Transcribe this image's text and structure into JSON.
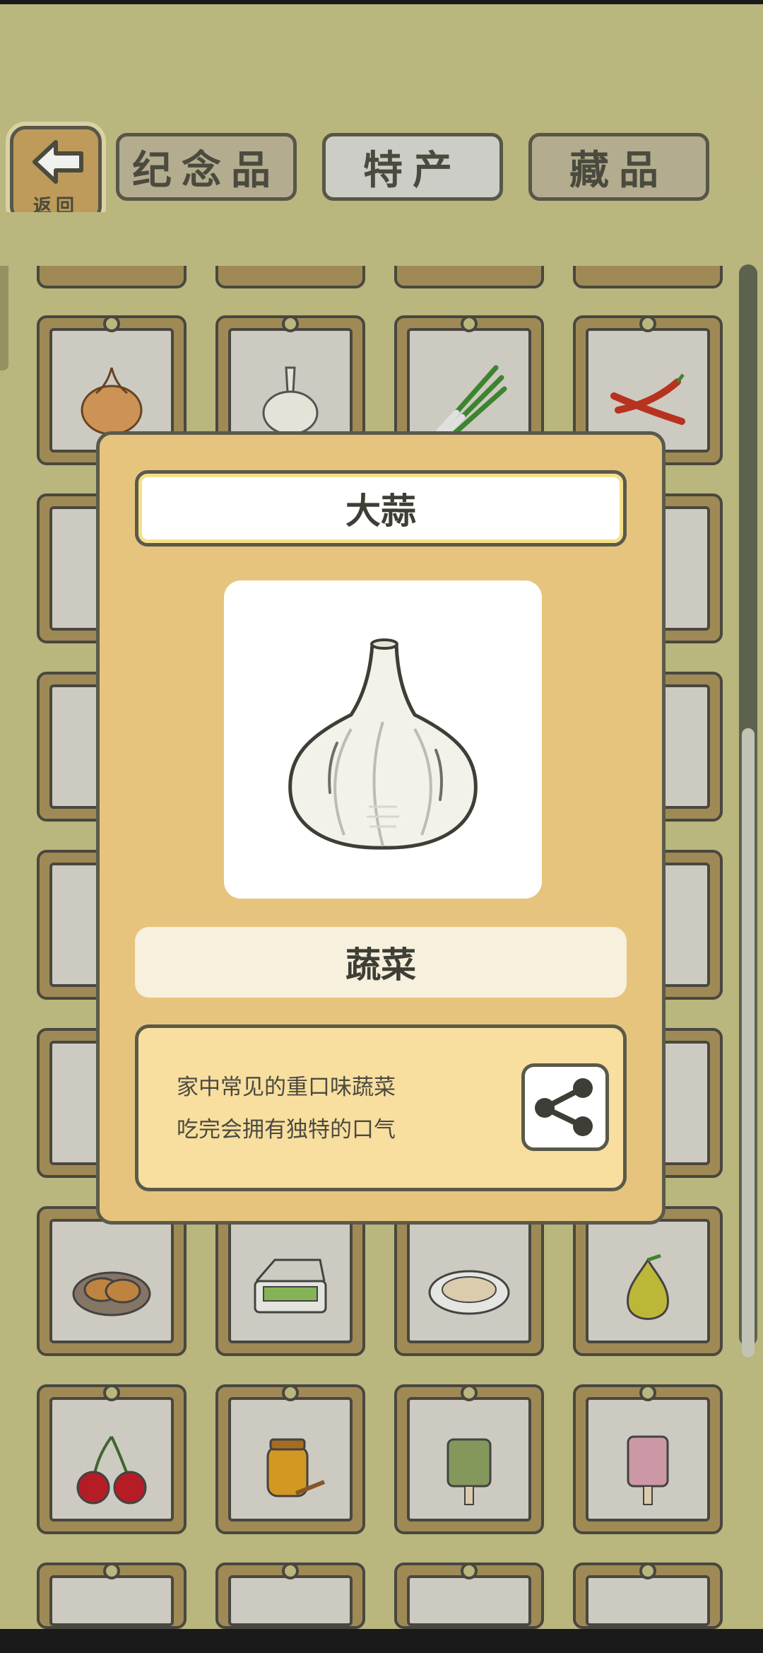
{
  "nav": {
    "back_label": "返回",
    "tabs": [
      {
        "label": "纪念品",
        "active": false
      },
      {
        "label": "特产",
        "active": true
      },
      {
        "label": "藏品",
        "active": false
      }
    ]
  },
  "grid": {
    "items": [
      {
        "icon": "onion-icon"
      },
      {
        "icon": "garlic-icon"
      },
      {
        "icon": "scallion-icon"
      },
      {
        "icon": "chili-pepper-icon"
      },
      {
        "icon": "bun-icon"
      },
      {
        "icon": "lunchbox-icon"
      },
      {
        "icon": "dumplings-plate-icon"
      },
      {
        "icon": "pear-icon"
      },
      {
        "icon": "cherries-icon"
      },
      {
        "icon": "honey-jar-icon"
      },
      {
        "icon": "jade-mask-icon"
      },
      {
        "icon": "pink-mask-icon"
      }
    ]
  },
  "detail": {
    "name": "大蒜",
    "category": "蔬菜",
    "description_line1": "家中常见的重口味蔬菜",
    "description_line2": "吃完会拥有独特的口气",
    "image": "garlic-icon",
    "share_icon": "share-icon"
  },
  "colors": {
    "background": "#c4c085",
    "modal": "#e6c47e",
    "card_frame": "#a8915a",
    "outline": "#5a5a4a"
  }
}
